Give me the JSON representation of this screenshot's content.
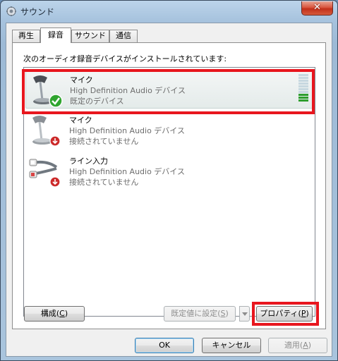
{
  "window": {
    "title": "サウンド",
    "close_label": "✕"
  },
  "tabs": [
    {
      "label": "再生",
      "active": false
    },
    {
      "label": "録音",
      "active": true
    },
    {
      "label": "サウンド",
      "active": false
    },
    {
      "label": "通信",
      "active": false
    }
  ],
  "panel": {
    "instruction": "次のオーディオ録音デバイスがインストールされています:"
  },
  "devices": [
    {
      "name": "マイク",
      "driver": "High Definition Audio デバイス",
      "status": "既定のデバイス",
      "icon": "microphone-icon",
      "badge": "check-badge-icon",
      "selected": true,
      "level_fraction": 0.3
    },
    {
      "name": "マイク",
      "driver": "High Definition Audio デバイス",
      "status": "接続されていません",
      "icon": "microphone-icon",
      "badge": "unplugged-badge-icon",
      "selected": false
    },
    {
      "name": "ライン入力",
      "driver": "High Definition Audio デバイス",
      "status": "接続されていません",
      "icon": "line-in-cable-icon",
      "badge": "unplugged-badge-icon",
      "selected": false
    }
  ],
  "buttons": {
    "configure": {
      "text": "構成(",
      "key": "C",
      "suffix": ")"
    },
    "set_default": {
      "text": "既定値に設定(",
      "key": "S",
      "suffix": ")"
    },
    "properties": {
      "text": "プロパティ(",
      "key": "P",
      "suffix": ")"
    },
    "ok": "OK",
    "cancel": "キャンセル",
    "apply": {
      "text": "適用(",
      "key": "A",
      "suffix": ")"
    }
  },
  "colors": {
    "highlight": "#e8161e",
    "level_on": "#2e9e2e",
    "check_green": "#2fa52f",
    "unplugged_red": "#cc2a2a"
  }
}
